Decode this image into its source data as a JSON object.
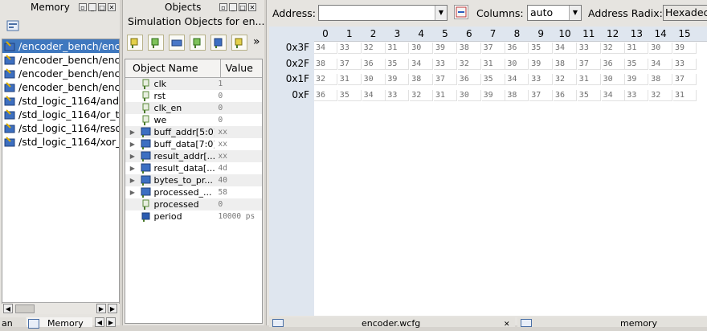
{
  "memory_panel": {
    "title": "Memory",
    "items": [
      {
        "label": "/encoder_bench/enc",
        "selected": true
      },
      {
        "label": "/encoder_bench/enc",
        "selected": false
      },
      {
        "label": "/encoder_bench/enc",
        "selected": false
      },
      {
        "label": "/encoder_bench/enc",
        "selected": false
      },
      {
        "label": "/std_logic_1164/and",
        "selected": false
      },
      {
        "label": "/std_logic_1164/or_t",
        "selected": false
      },
      {
        "label": "/std_logic_1164/reso",
        "selected": false
      },
      {
        "label": "/std_logic_1164/xor_",
        "selected": false
      }
    ],
    "bottom_tabs": [
      "an",
      "Memory"
    ]
  },
  "objects_panel": {
    "title": "Objects",
    "subtitle": "Simulation Objects for en...",
    "more": "»",
    "col_name": "Object Name",
    "col_value": "Value",
    "rows": [
      {
        "name": "clk",
        "value": "1",
        "expandable": false,
        "bus": false
      },
      {
        "name": "rst",
        "value": "0",
        "expandable": false,
        "bus": false
      },
      {
        "name": "clk_en",
        "value": "0",
        "expandable": false,
        "bus": false
      },
      {
        "name": "we",
        "value": "0",
        "expandable": false,
        "bus": false
      },
      {
        "name": "buff_addr[5:0]",
        "value": "xx",
        "expandable": true,
        "bus": true
      },
      {
        "name": "buff_data[7:0]",
        "value": "xx",
        "expandable": true,
        "bus": true
      },
      {
        "name": "result_addr[...",
        "value": "xx",
        "expandable": true,
        "bus": true
      },
      {
        "name": "result_data[...",
        "value": "4d",
        "expandable": true,
        "bus": true
      },
      {
        "name": "bytes_to_pr...",
        "value": "40",
        "expandable": true,
        "bus": true
      },
      {
        "name": "processed_...",
        "value": "58",
        "expandable": true,
        "bus": true
      },
      {
        "name": "processed",
        "value": "0",
        "expandable": false,
        "bus": false
      },
      {
        "name": "period",
        "value": "10000 ps",
        "expandable": false,
        "bus": false,
        "constant": true
      }
    ]
  },
  "editor": {
    "address_label": "Address:",
    "address_value": "",
    "columns_label": "Columns:",
    "columns_value": "auto",
    "radix_label": "Address Radix:",
    "radix_value": "Hexadec",
    "columns": [
      "0",
      "1",
      "2",
      "3",
      "4",
      "5",
      "6",
      "7",
      "8",
      "9",
      "10",
      "11",
      "12",
      "13",
      "14",
      "15"
    ],
    "rows": [
      {
        "addr": "0x3F",
        "cells": [
          "34",
          "33",
          "32",
          "31",
          "30",
          "39",
          "38",
          "37",
          "36",
          "35",
          "34",
          "33",
          "32",
          "31",
          "30",
          "39"
        ]
      },
      {
        "addr": "0x2F",
        "cells": [
          "38",
          "37",
          "36",
          "35",
          "34",
          "33",
          "32",
          "31",
          "30",
          "39",
          "38",
          "37",
          "36",
          "35",
          "34",
          "33"
        ]
      },
      {
        "addr": "0x1F",
        "cells": [
          "32",
          "31",
          "30",
          "39",
          "38",
          "37",
          "36",
          "35",
          "34",
          "33",
          "32",
          "31",
          "30",
          "39",
          "38",
          "37"
        ]
      },
      {
        "addr": "0xF",
        "cells": [
          "36",
          "35",
          "34",
          "33",
          "32",
          "31",
          "30",
          "39",
          "38",
          "37",
          "36",
          "35",
          "34",
          "33",
          "32",
          "31"
        ]
      }
    ],
    "bottom_tabs": [
      "encoder.wcfg",
      "memory"
    ]
  }
}
